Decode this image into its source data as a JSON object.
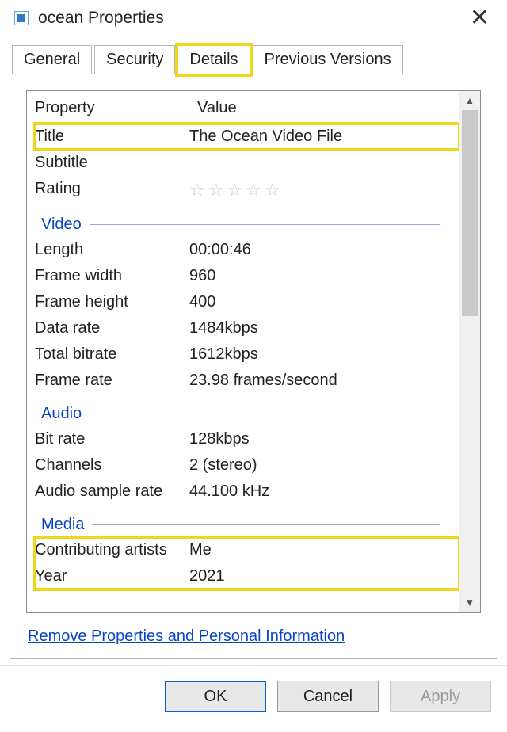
{
  "window": {
    "title": "ocean Properties"
  },
  "tabs": {
    "general": "General",
    "security": "Security",
    "details": "Details",
    "previous": "Previous Versions",
    "active": "details"
  },
  "headers": {
    "property": "Property",
    "value": "Value"
  },
  "description": {
    "title": {
      "label": "Title",
      "value": "The Ocean Video File"
    },
    "subtitle": {
      "label": "Subtitle",
      "value": ""
    },
    "rating": {
      "label": "Rating",
      "value": 0
    }
  },
  "groups": {
    "video": "Video",
    "audio": "Audio",
    "media": "Media"
  },
  "video": {
    "length": {
      "label": "Length",
      "value": "00:00:46"
    },
    "framewidth": {
      "label": "Frame width",
      "value": "960"
    },
    "frameheight": {
      "label": "Frame height",
      "value": "400"
    },
    "datarate": {
      "label": "Data rate",
      "value": "1484kbps"
    },
    "totalbitrate": {
      "label": "Total bitrate",
      "value": "1612kbps"
    },
    "framerate": {
      "label": "Frame rate",
      "value": "23.98 frames/second"
    }
  },
  "audio": {
    "bitrate": {
      "label": "Bit rate",
      "value": "128kbps"
    },
    "channels": {
      "label": "Channels",
      "value": "2 (stereo)"
    },
    "samplerate": {
      "label": "Audio sample rate",
      "value": "44.100 kHz"
    }
  },
  "media": {
    "artists": {
      "label": "Contributing artists",
      "value": "Me"
    },
    "year": {
      "label": "Year",
      "value": "2021"
    }
  },
  "link": "Remove Properties and Personal Information",
  "buttons": {
    "ok": "OK",
    "cancel": "Cancel",
    "apply": "Apply"
  }
}
